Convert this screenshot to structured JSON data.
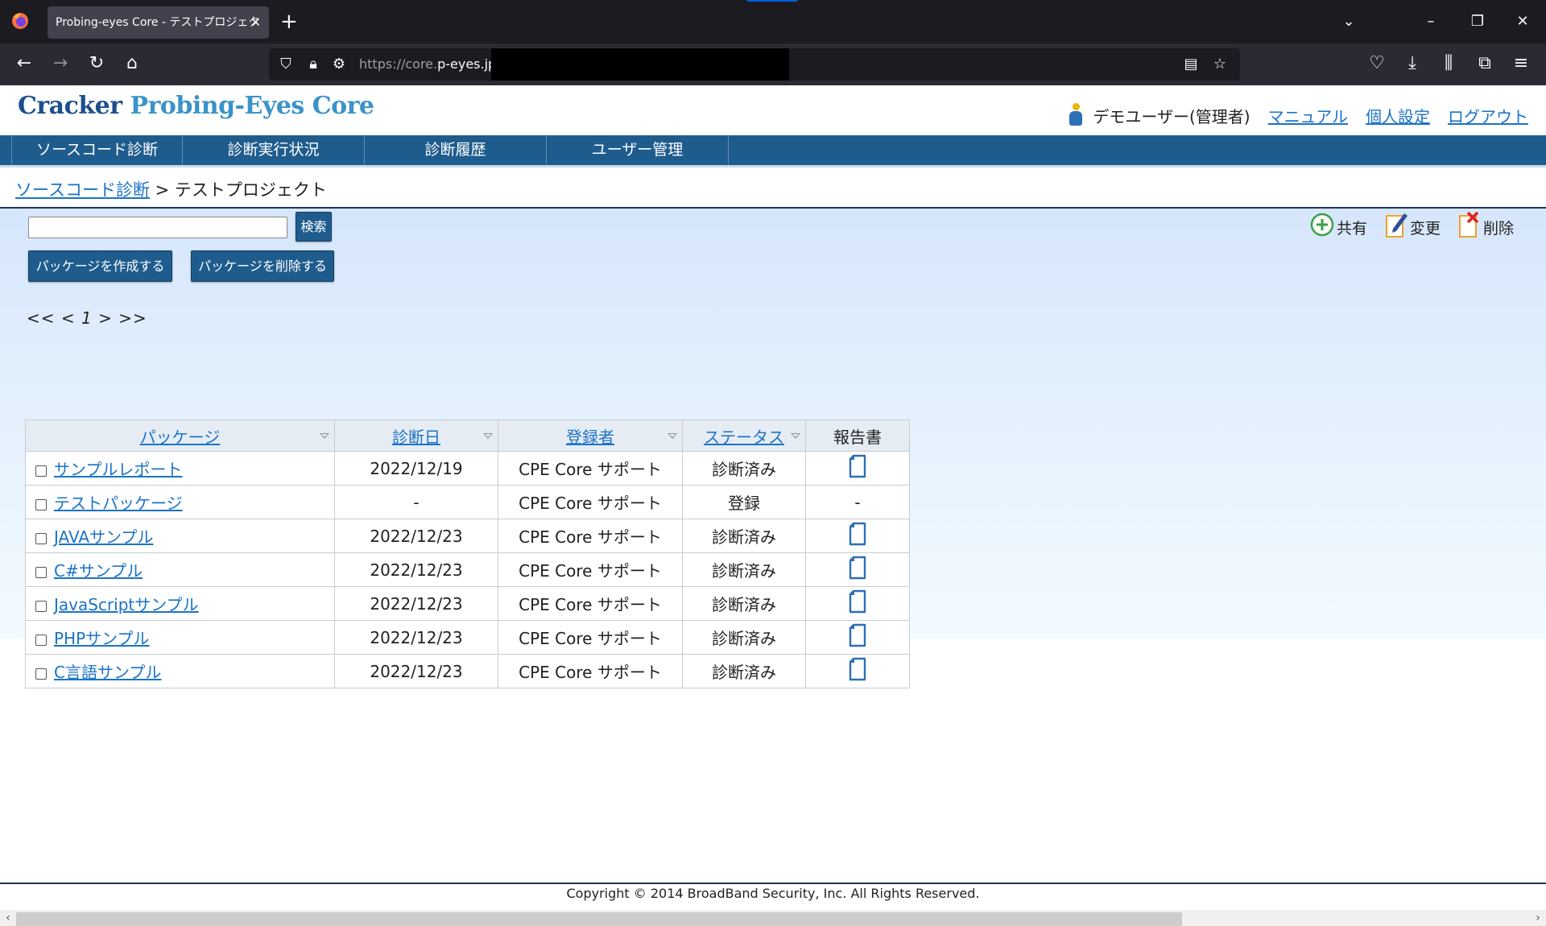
{
  "browser": {
    "tab_title": "Probing-eyes Core - テストプロジェクト",
    "url_dim": "https://core.",
    "url_host": "p-eyes.jp"
  },
  "brand": {
    "part1": "Cracker",
    "part2": "Probing-Eyes Core"
  },
  "user": {
    "name": "デモユーザー(管理者)",
    "links": [
      "マニュアル",
      "個人設定",
      "ログアウト"
    ]
  },
  "menu": [
    "ソースコード診断",
    "診断実行状況",
    "診断履歴",
    "ユーザー管理"
  ],
  "breadcrumb": {
    "link": "ソースコード診断",
    "separator": " > ",
    "current": "テストプロジェクト"
  },
  "search": {
    "value": "",
    "button": "検索"
  },
  "buttons": {
    "create": "パッケージを作成する",
    "delete": "パッケージを削除する"
  },
  "actions": {
    "share": "共有",
    "edit": "変更",
    "remove": "削除"
  },
  "pager": {
    "first": "<<",
    "prev": "<",
    "current": "1",
    "next": ">",
    "last": ">>"
  },
  "table": {
    "headers": [
      "パッケージ",
      "診断日",
      "登録者",
      "ステータス",
      "報告書"
    ],
    "rows": [
      {
        "name": "サンプルレポート",
        "date": "2022/12/19",
        "owner": "CPE Core サポート",
        "status": "診断済み",
        "report": true
      },
      {
        "name": "テストパッケージ",
        "date": "-",
        "owner": "CPE Core サポート",
        "status": "登録",
        "report": false,
        "report_text": "-"
      },
      {
        "name": "JAVAサンプル",
        "date": "2022/12/23",
        "owner": "CPE Core サポート",
        "status": "診断済み",
        "report": true
      },
      {
        "name": "C#サンプル",
        "date": "2022/12/23",
        "owner": "CPE Core サポート",
        "status": "診断済み",
        "report": true
      },
      {
        "name": "JavaScriptサンプル",
        "date": "2022/12/23",
        "owner": "CPE Core サポート",
        "status": "診断済み",
        "report": true
      },
      {
        "name": "PHPサンプル",
        "date": "2022/12/23",
        "owner": "CPE Core サポート",
        "status": "診断済み",
        "report": true
      },
      {
        "name": "C言語サンプル",
        "date": "2022/12/23",
        "owner": "CPE Core サポート",
        "status": "診断済み",
        "report": true
      }
    ]
  },
  "footer": "Copyright © 2014 BroadBand Security, Inc. All Rights Reserved."
}
